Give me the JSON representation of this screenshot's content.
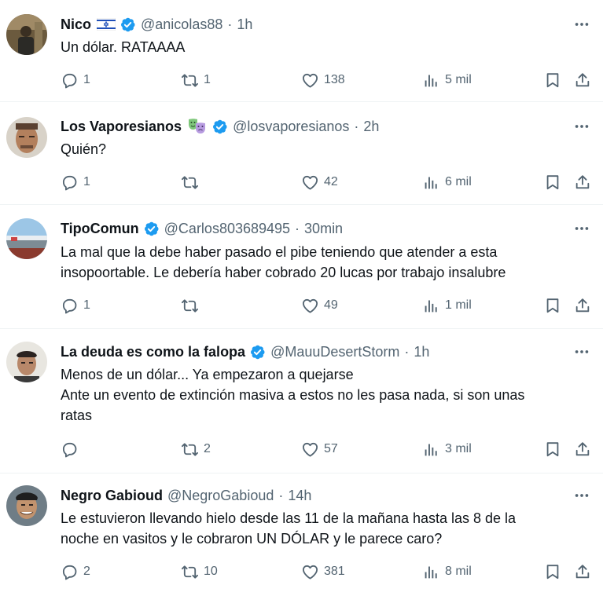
{
  "colors": {
    "verified": "#1d9bf0",
    "meta": "#536471",
    "text": "#0f1419"
  },
  "tweets": [
    {
      "name": "Nico",
      "handle": "@anicolas88",
      "separator": "·",
      "time": "1h",
      "text": "Un dólar. RATAAAA",
      "replies": "1",
      "retweets": "1",
      "likes": "138",
      "views": "5 mil",
      "emoji": "israel-flag"
    },
    {
      "name": "Los Vaporesianos",
      "handle": "@losvaporesianos",
      "separator": "·",
      "time": "2h",
      "text": "Quién?",
      "replies": "1",
      "retweets": "",
      "likes": "42",
      "views": "6 mil",
      "emoji": "theater-masks"
    },
    {
      "name": "TipoComun",
      "handle": "@Carlos803689495",
      "separator": "·",
      "time": "30min",
      "text": "La mal que la debe haber pasado el pibe teniendo que atender a esta\ninsopoortable. Le debería haber cobrado 20 lucas por trabajo insalubre",
      "replies": "1",
      "retweets": "",
      "likes": "49",
      "views": "1 mil"
    },
    {
      "name": "La deuda es como la falopa",
      "handle": "@MauuDesertStorm",
      "separator": "·",
      "time": "1h",
      "text": "Menos de un dólar... Ya empezaron a quejarse\n Ante un evento de extinción masiva a estos no les pasa nada, si son unas\nratas",
      "replies": "",
      "retweets": "2",
      "likes": "57",
      "views": "3 mil"
    },
    {
      "name": "Negro Gabioud",
      "handle": "@NegroGabioud",
      "separator": "·",
      "time": "14h",
      "text": "Le estuvieron llevando hielo desde las 11 de la mañana hasta las 8 de la\nnoche en vasitos y le cobraron UN DÓLAR y le parece caro?",
      "replies": "2",
      "retweets": "10",
      "likes": "381",
      "views": "8 mil"
    }
  ]
}
